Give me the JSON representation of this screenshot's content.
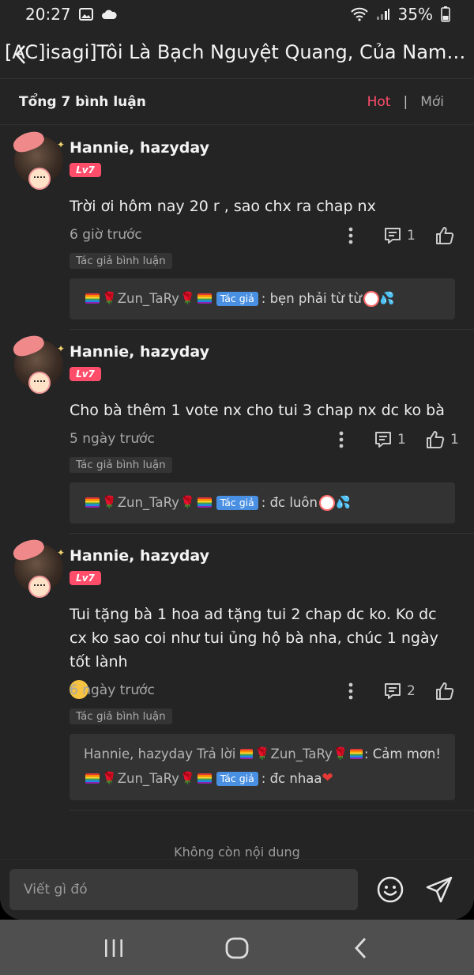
{
  "status_bar": {
    "time": "20:27",
    "battery": "35%",
    "icons": [
      "image-icon",
      "cloud-icon",
      "wifi-icon",
      "signal-icon",
      "battery-icon"
    ]
  },
  "header": {
    "title": "[AC]isagi]Tôi Là Bạch Nguyệt Quang, Của Nam Chính",
    "back_icon": "chevron-left-icon"
  },
  "comments_header": {
    "total": "Tổng 7 bình luận",
    "sort_hot": "Hot",
    "sort_separator": "|",
    "sort_new": "Mới"
  },
  "comments": [
    {
      "user": "Hannie, hazyday",
      "level": "Lv7",
      "text": "Trời  ơi hôm nay 20 r , sao chx ra chap nx",
      "time": "6 giờ trước",
      "replies": "1",
      "likes": "",
      "author_tag": "Tác giả bình luận",
      "reply": {
        "name": "Zun_TaRy",
        "author_label": "Tác giả",
        "text": ": bẹn phải từ từ"
      }
    },
    {
      "user": "Hannie, hazyday",
      "level": "Lv7",
      "text": "Cho bà thêm 1 vote nx cho tui 3 chap nx dc ko bà",
      "time": "5 ngày trước",
      "replies": "1",
      "likes": "1",
      "author_tag": "Tác giả bình luận",
      "reply": {
        "name": "Zun_TaRy",
        "author_label": "Tác giả",
        "text": ": đc luôn"
      }
    },
    {
      "user": "Hannie, hazyday",
      "level": "Lv7",
      "text": "Tui tặng bà 1 hoa ad tặng tui 2 chap dc ko. Ko dc cx ko sao coi như tui ủng hộ bà nha, chúc 1 ngày tốt lành",
      "time": "6 ngày trước",
      "replies": "2",
      "likes": "",
      "author_tag": "Tác giả bình luận",
      "reply_first": {
        "prefix": "Hannie, hazyday Trả lời",
        "name": "Zun_TaRy",
        "text": ": Cảm mơn!"
      },
      "reply": {
        "name": "Zun_TaRy",
        "author_label": "Tác giả",
        "text": ": đc nhaa"
      }
    }
  ],
  "footer_note": "Không còn nội dung",
  "input": {
    "placeholder": "Viết gì đó"
  },
  "nav": {
    "icons": [
      "recent-apps-icon",
      "home-icon",
      "back-icon"
    ]
  },
  "colors": {
    "accent": "#ff4d6a",
    "author_badge": "#4a90e2",
    "background": "#242424"
  }
}
